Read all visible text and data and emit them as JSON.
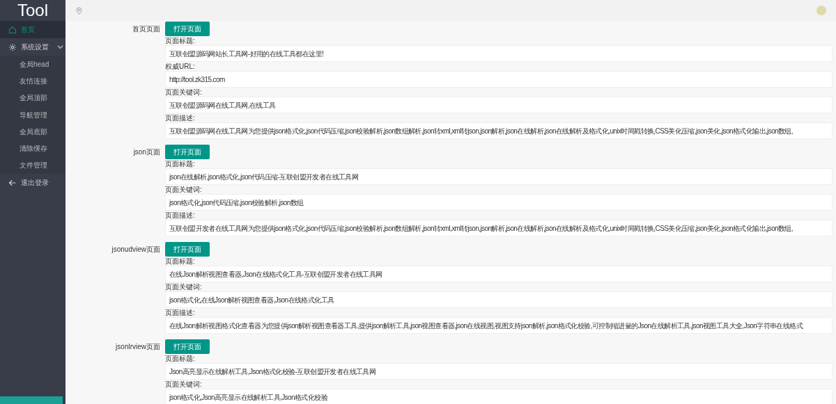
{
  "sidebar": {
    "logo": "Tool",
    "items": [
      {
        "label": "首页",
        "selected": true
      },
      {
        "label": "系统设置",
        "selected": false,
        "expanded": true,
        "children": [
          {
            "label": "全局head"
          },
          {
            "label": "友情连接"
          },
          {
            "label": "全局顶部"
          },
          {
            "label": "导航管理"
          },
          {
            "label": "全局底部"
          },
          {
            "label": "清除缓存"
          },
          {
            "label": "文件管理"
          }
        ]
      },
      {
        "label": "退出登录",
        "selected": false
      }
    ]
  },
  "sections": [
    {
      "name": "首页页面",
      "button": "打开页面",
      "fields": [
        {
          "label": "页面标题:",
          "value": "互联创盟源码网站长工具网-好用的在线工具都在这里!"
        },
        {
          "label": "权威URL:",
          "value": "http://tool.zk315.com"
        },
        {
          "label": "页面关键词:",
          "value": "互联创盟源码网在线工具网,在线工具"
        },
        {
          "label": "页面描述:",
          "value": "互联创盟源码网在线工具网为您提供json格式化,json代码压缩,json校验解析,json数组解析,json转xml,xml转json,json解析,json在线解析,json在线解析及格式化,unix时间戳转换,CSS美化压缩,json美化,json格式化输出,json数组,"
        }
      ]
    },
    {
      "name": "json页面",
      "button": "打开页面",
      "fields": [
        {
          "label": "页面标题:",
          "value": "json在线解析,json格式化,json代码压缩-互联创盟开发者在线工具网"
        },
        {
          "label": "页面关键词:",
          "value": "json格式化,json代码压缩,json校验解析,json数组"
        },
        {
          "label": "页面描述:",
          "value": "互联创盟开发者在线工具网为您提供json格式化,json代码压缩,json校验解析,json数组解析,json转xml,xml转json,json解析,json在线解析,json在线解析及格式化,unix时间戳转换,CSS美化压缩,json美化,json格式化输出,json数组,"
        }
      ]
    },
    {
      "name": "jsonudview页面",
      "button": "打开页面",
      "fields": [
        {
          "label": "页面标题:",
          "value": "在线Json解析视图查看器,Json在线格式化工具-互联创盟开发者在线工具网"
        },
        {
          "label": "页面关键词:",
          "value": "json格式化,在线Json解析视图查看器,Json在线格式化工具"
        },
        {
          "label": "页面描述:",
          "value": "在线Json解析视图格式化查看器为您提供json解析视图查看器工具,提供json解析工具,json视图查看器,json在线视图,视图支持json解析,json格式化校验,可控制缩进量的Json在线解析工具,json视图工具大全,Json字符串在线格式"
        }
      ]
    },
    {
      "name": "jsonlrview页面",
      "button": "打开页面",
      "fields": [
        {
          "label": "页面标题:",
          "value": "Json高亮显示在线解析工具,Json格式化校验-互联创盟开发者在线工具网"
        },
        {
          "label": "页面关键词:",
          "value": "json格式化,Json高亮显示在线解析工具,Json格式化校验"
        }
      ]
    }
  ]
}
